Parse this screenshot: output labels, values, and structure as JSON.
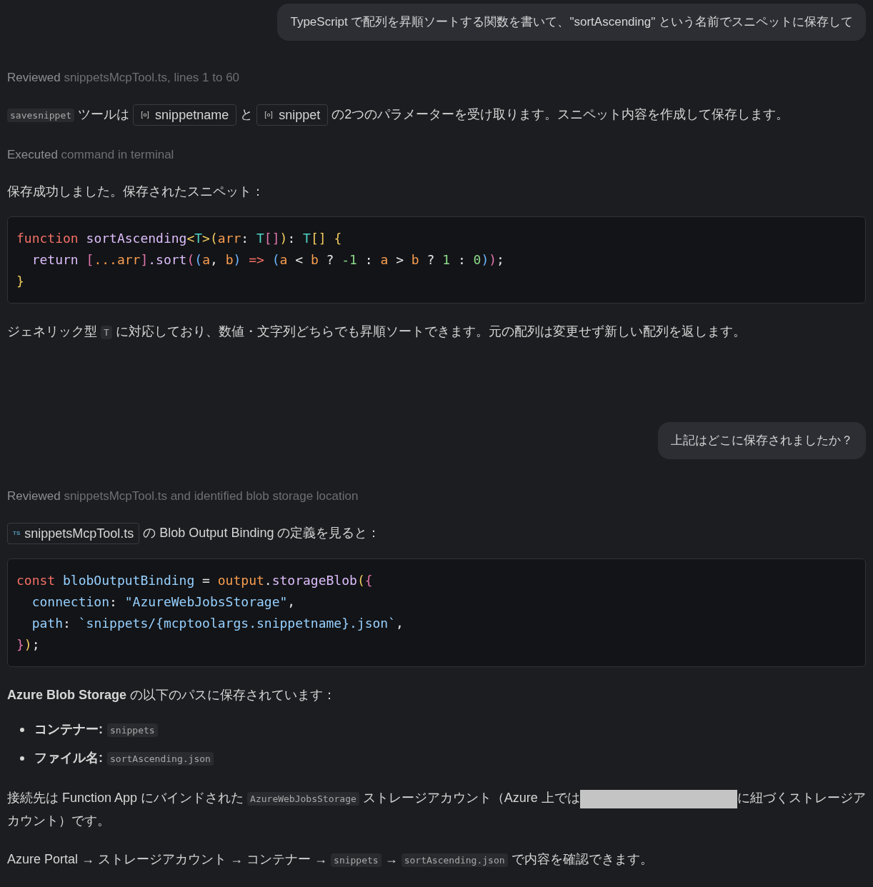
{
  "messages": [
    {
      "kind": "user",
      "text": "TypeScript で配列を昇順ソートする関数を書いて、\"sortAscending\" という名前でスニペットに保存して"
    },
    {
      "kind": "status",
      "verb": "Reviewed",
      "detail": "snippetsMcpTool.ts, lines 1 to 60"
    },
    {
      "kind": "paragraph",
      "parts": [
        {
          "kind": "code",
          "text": "savesnippet"
        },
        {
          "kind": "text",
          "text": " ツールは "
        },
        {
          "kind": "symbol",
          "text": "snippetname"
        },
        {
          "kind": "text",
          "text": " と "
        },
        {
          "kind": "symbol",
          "text": "snippet"
        },
        {
          "kind": "text",
          "text": " の2つのパラメーターを受け取ります。スニペット内容を作成して保存します。"
        }
      ]
    },
    {
      "kind": "status",
      "verb": "Executed",
      "detail": "command in terminal"
    },
    {
      "kind": "paragraph",
      "parts": [
        {
          "kind": "text",
          "text": "保存成功しました。保存されたスニペット："
        }
      ]
    },
    {
      "kind": "code",
      "lines": [
        [
          {
            "t": "function",
            "color": "#f47067"
          },
          {
            "t": " sortAscending",
            "color": "#dcbdfb"
          },
          {
            "t": "<",
            "color": "#f2cc60"
          },
          {
            "t": "T",
            "color": "#4fd1c5"
          },
          {
            "t": ">",
            "color": "#f2cc60"
          },
          {
            "t": "(",
            "color": "#f2cc60"
          },
          {
            "t": "arr",
            "color": "#f69d50"
          },
          {
            "t": ": "
          },
          {
            "t": "T",
            "color": "#4fd1c5"
          },
          {
            "t": "[]",
            "color": "#e275ad"
          },
          {
            "t": ")",
            "color": "#f2cc60"
          },
          {
            "t": ": "
          },
          {
            "t": "T",
            "color": "#4fd1c5"
          },
          {
            "t": "[]",
            "color": "#f2cc60"
          },
          {
            "t": " {",
            "color": "#f2cc60"
          }
        ],
        [
          {
            "t": "  return",
            "color": "#dcbdfb"
          },
          {
            "t": " [",
            "color": "#e275ad"
          },
          {
            "t": "...arr",
            "color": "#f69d50"
          },
          {
            "t": "]",
            "color": "#e275ad"
          },
          {
            "t": ".sort",
            "color": "#dcbdfb"
          },
          {
            "t": "(",
            "color": "#e275ad"
          },
          {
            "t": "(",
            "color": "#6cb6ff"
          },
          {
            "t": "a",
            "color": "#f69d50"
          },
          {
            "t": ", "
          },
          {
            "t": "b",
            "color": "#f69d50"
          },
          {
            "t": ")",
            "color": "#6cb6ff"
          },
          {
            "t": " =>",
            "color": "#f47067"
          },
          {
            "t": " (",
            "color": "#6cb6ff"
          },
          {
            "t": "a",
            "color": "#f69d50"
          },
          {
            "t": " < "
          },
          {
            "t": "b",
            "color": "#f69d50"
          },
          {
            "t": " ? "
          },
          {
            "t": "-1",
            "color": "#8ddb8c"
          },
          {
            "t": " : "
          },
          {
            "t": "a",
            "color": "#f69d50"
          },
          {
            "t": " > "
          },
          {
            "t": "b",
            "color": "#f69d50"
          },
          {
            "t": " ? "
          },
          {
            "t": "1",
            "color": "#8ddb8c"
          },
          {
            "t": " : "
          },
          {
            "t": "0",
            "color": "#8ddb8c"
          },
          {
            "t": ")",
            "color": "#6cb6ff"
          },
          {
            "t": ")",
            "color": "#e275ad"
          },
          {
            "t": ";"
          }
        ],
        [
          {
            "t": "}",
            "color": "#f2cc60"
          }
        ]
      ]
    },
    {
      "kind": "paragraph",
      "parts": [
        {
          "kind": "text",
          "text": "ジェネリック型 "
        },
        {
          "kind": "code",
          "text": "T"
        },
        {
          "kind": "text",
          "text": " に対応しており、数値・文字列どちらでも昇順ソートできます。元の配列は変更せず新しい配列を返します。"
        }
      ]
    },
    {
      "kind": "user",
      "text": "上記はどこに保存されましたか？"
    },
    {
      "kind": "status",
      "verb": "Reviewed",
      "detail": "snippetsMcpTool.ts and identified blob storage location"
    },
    {
      "kind": "paragraph",
      "parts": [
        {
          "kind": "file",
          "badge": "TS",
          "text": "snippetsMcpTool.ts"
        },
        {
          "kind": "text",
          "text": " の Blob Output Binding の定義を見ると："
        }
      ]
    },
    {
      "kind": "code",
      "lines": [
        [
          {
            "t": "const",
            "color": "#f47067"
          },
          {
            "t": " blobOutputBinding",
            "color": "#96d0ff"
          },
          {
            "t": " = "
          },
          {
            "t": "output",
            "color": "#f69d50"
          },
          {
            "t": "."
          },
          {
            "t": "storageBlob",
            "color": "#dcbdfb"
          },
          {
            "t": "(",
            "color": "#f2cc60"
          },
          {
            "t": "{",
            "color": "#e275ad"
          }
        ],
        [
          {
            "t": "  connection",
            "color": "#96d0ff"
          },
          {
            "t": ": "
          },
          {
            "t": "\"AzureWebJobsStorage\"",
            "color": "#96d0ff"
          },
          {
            "t": ","
          }
        ],
        [
          {
            "t": "  path",
            "color": "#96d0ff"
          },
          {
            "t": ": "
          },
          {
            "t": "`snippets/{mcptoolargs.snippetname}.json`",
            "color": "#96d0ff"
          },
          {
            "t": ","
          }
        ],
        [
          {
            "t": "}",
            "color": "#e275ad"
          },
          {
            "t": ")",
            "color": "#f2cc60"
          },
          {
            "t": ";"
          }
        ]
      ]
    },
    {
      "kind": "paragraph",
      "parts": [
        {
          "kind": "text",
          "text": "**Azure Blob Storage** の以下のパスに保存されています："
        }
      ]
    },
    {
      "kind": "list",
      "items": [
        [
          {
            "kind": "label",
            "text": "コンテナー:"
          },
          {
            "kind": "code",
            "text": "snippets"
          }
        ],
        [
          {
            "kind": "label",
            "text": "ファイル名:"
          },
          {
            "kind": "code",
            "text": "sortAscending.json"
          }
        ]
      ]
    },
    {
      "kind": "paragraph",
      "parts": [
        {
          "kind": "text",
          "text": "接続先は Function App にバインドされた "
        },
        {
          "kind": "code",
          "text": "AzureWebJobsStorage"
        },
        {
          "kind": "text",
          "text": " ストレージアカウント（Azure 上では"
        },
        {
          "kind": "redacted"
        },
        {
          "kind": "text",
          "text": "に紐づくストレージアカウント）です。"
        }
      ]
    },
    {
      "kind": "paragraph",
      "parts": [
        {
          "kind": "text",
          "text": "Azure Portal → ストレージアカウント → コンテナー → "
        },
        {
          "kind": "code",
          "text": "snippets"
        },
        {
          "kind": "text",
          "text": " → "
        },
        {
          "kind": "code",
          "text": "sortAscending.json"
        },
        {
          "kind": "text",
          "text": " で内容を確認できます。"
        }
      ]
    }
  ]
}
